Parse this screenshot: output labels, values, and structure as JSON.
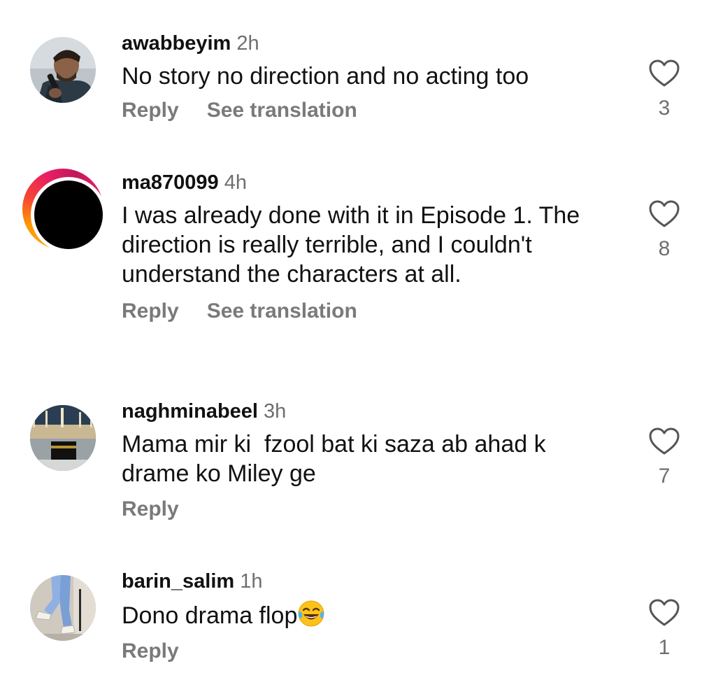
{
  "comments": [
    {
      "username": "awabbeyim",
      "time": "2h",
      "text": "No story no direction and no acting too",
      "reply_label": "Reply",
      "translation_label": "See translation",
      "likes": "3",
      "avatar_icon": "man-with-microphone-avatar"
    },
    {
      "username": "ma870099",
      "time": "4h",
      "text": "I was already done with it in Episode 1. The direction is really terrible, and I couldn't understand the characters at all.",
      "reply_label": "Reply",
      "translation_label": "See translation",
      "likes": "8",
      "avatar_icon": "black-circle-avatar-with-story-ring"
    },
    {
      "username": "naghminabeel",
      "time": "3h",
      "text": "Mama mir ki  fzool bat ki saza ab ahad k drame ko Miley ge",
      "reply_label": "Reply",
      "likes": "7",
      "avatar_icon": "kaaba-avatar"
    },
    {
      "username": "barin_salim",
      "time": "1h",
      "text": "Dono drama flop",
      "emoji": "laughing-tears-emoji",
      "reply_label": "Reply",
      "likes": "1",
      "avatar_icon": "jeans-and-sneakers-avatar"
    }
  ],
  "colors": {
    "primary_text": "#111111",
    "secondary_text": "#6f6f6f",
    "action_text": "#7a7a7a",
    "heart_stroke": "#555555"
  }
}
